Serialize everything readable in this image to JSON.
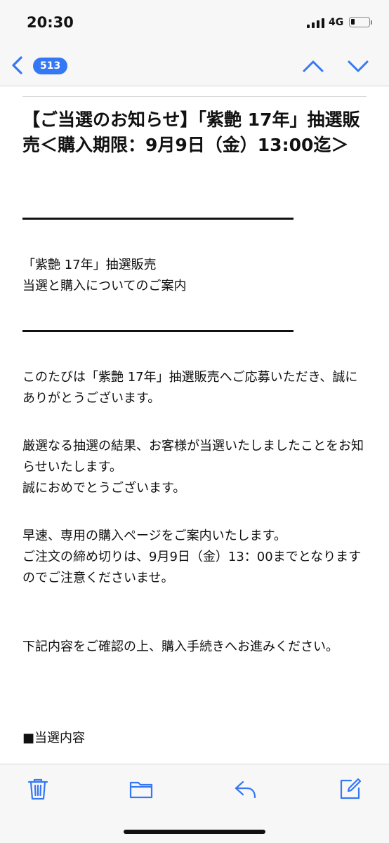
{
  "status": {
    "time": "20:30",
    "network": "4G"
  },
  "nav": {
    "unread_count": "513"
  },
  "email": {
    "subject": "【ご当選のお知らせ】「紫艶 17年」抽選販売＜購入期限：9月9日（金）13:00迄＞",
    "header_line1": "「紫艶 17年」抽選販売",
    "header_line2": "当選と購入についてのご案内",
    "para1": "このたびは「紫艶 17年」抽選販売へご応募いただき、誠にありがとうございます。",
    "para2_line1": "厳選なる抽選の結果、お客様が当選いたしましたことをお知らせいたします。",
    "para2_line2": "誠におめでとうございます。",
    "para3_line1": "早速、専用の購入ページをご案内いたします。",
    "para3_line2": "ご注文の締め切りは、9月9日（金）13：00までとなりますのでご注意くださいませ。",
    "para4": "下記内容をご確認の上、購入手続きへお進みください。",
    "section_heading": "■当選内容"
  },
  "icons": {
    "back": "chevron-left-icon",
    "up": "chevron-up-icon",
    "down": "chevron-down-icon",
    "trash": "trash-icon",
    "folder": "folder-icon",
    "reply": "reply-icon",
    "compose": "compose-icon"
  },
  "colors": {
    "accent": "#3478f6",
    "bar_bg": "#f7f7f7"
  }
}
